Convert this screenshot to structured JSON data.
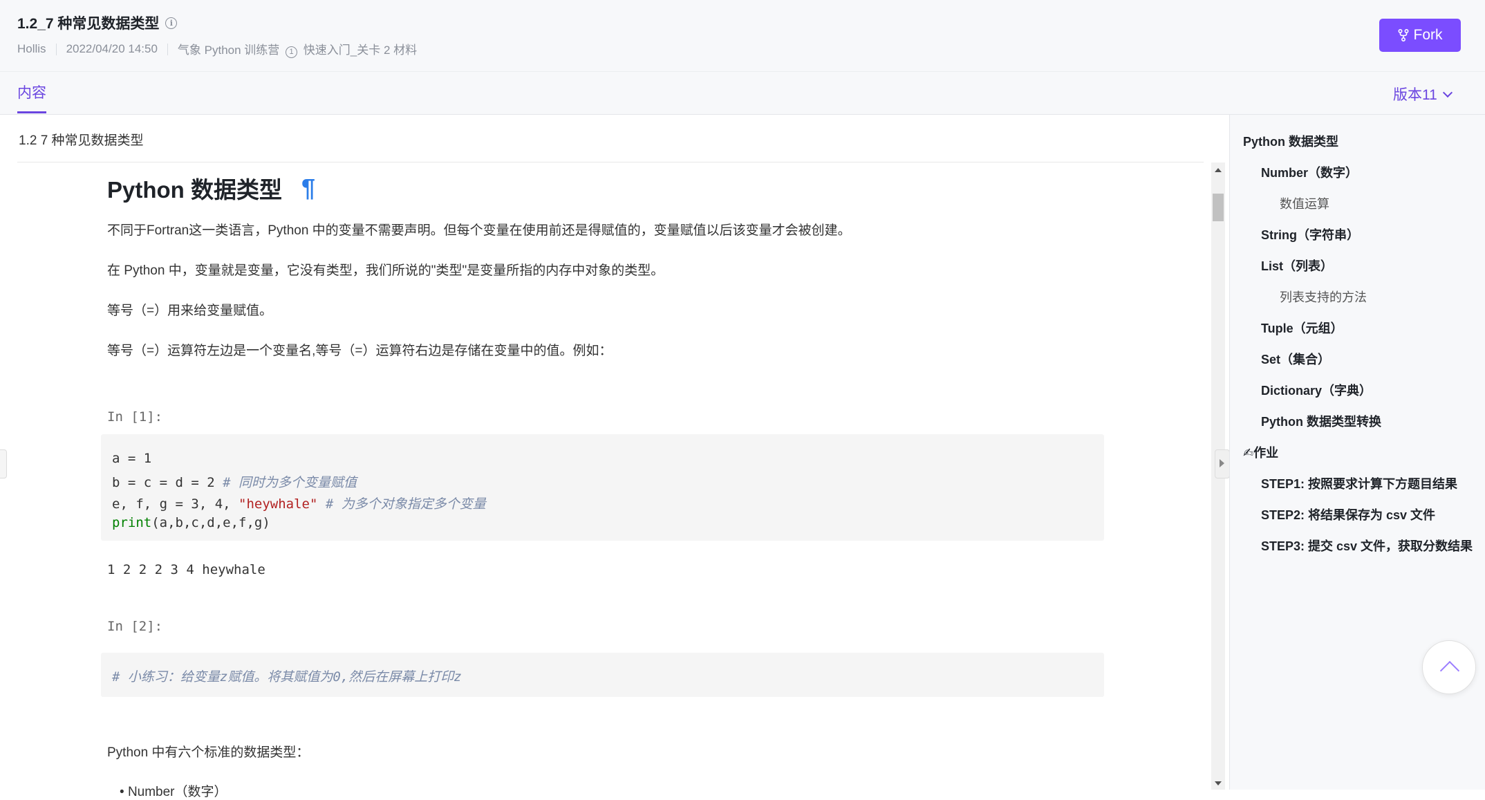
{
  "header": {
    "title": "1.2_7 种常见数据类型",
    "author": "Hollis",
    "datetime": "2022/04/20 14:50",
    "project_prefix": "气象 Python 训练营",
    "project_badge": "1",
    "project_suffix": "快速入门_关卡 2 材料",
    "fork_label": "Fork"
  },
  "tabs": {
    "content": "内容",
    "version": "版本11"
  },
  "breadcrumb": "1.2 7 种常见数据类型",
  "doc": {
    "heading": "Python 数据类型",
    "pilcrow": "¶",
    "p1": "不同于Fortran这一类语言，Python 中的变量不需要声明。但每个变量在使用前还是得赋值的，变量赋值以后该变量才会被创建。",
    "p2": "在 Python 中，变量就是变量，它没有类型，我们所说的\"类型\"是变量所指的内存中对象的类型。",
    "p3": "等号（=）用来给变量赋值。",
    "p4": "等号（=）运算符左边是一个变量名,等号（=）运算符右边是存储在变量中的值。例如：",
    "cell1": {
      "prompt": "In [1]:",
      "line1": "a = 1",
      "line2_code": "b = c = d = 2 ",
      "line2_comment": "# 同时为多个变量赋值",
      "line3_code": "e, f, g = 3, 4, ",
      "line3_string": "\"heywhale\"",
      "line3_comment": " # 为多个对象指定多个变量",
      "line4_kw": "print",
      "line4_rest": "(a,b,c,d,e,f,g)",
      "output": "1 2 2 2 3 4 heywhale"
    },
    "cell2": {
      "prompt": "In [2]:",
      "comment": "# 小练习：给变量z赋值。将其赋值为0,然后在屏幕上打印z"
    },
    "p5": "Python 中有六个标准的数据类型：",
    "list_first": "Number（数字）"
  },
  "toc": [
    {
      "label": "Python 数据类型",
      "level": 1
    },
    {
      "label": "Number（数字）",
      "level": 2
    },
    {
      "label": "数值运算",
      "level": 3
    },
    {
      "label": "String（字符串）",
      "level": 2
    },
    {
      "label": "List（列表）",
      "level": 2
    },
    {
      "label": "列表支持的方法",
      "level": 3
    },
    {
      "label": "Tuple（元组）",
      "level": 2
    },
    {
      "label": "Set（集合）",
      "level": 2
    },
    {
      "label": "Dictionary（字典）",
      "level": 2
    },
    {
      "label": "Python 数据类型转换",
      "level": 2
    },
    {
      "label": "✍作业",
      "level": 1
    },
    {
      "label": "STEP1: 按照要求计算下方题目结果",
      "level": 2
    },
    {
      "label": "STEP2: 将结果保存为 csv 文件",
      "level": 2
    },
    {
      "label": "STEP3: 提交 csv 文件，获取分数结果",
      "level": 2
    }
  ],
  "colors": {
    "accent": "#7b4dff",
    "link": "#6a45e0",
    "pilcrow": "#2b7de9"
  }
}
